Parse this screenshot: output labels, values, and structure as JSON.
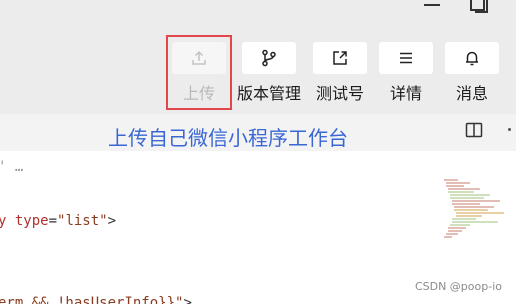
{
  "toolbar": {
    "items": [
      {
        "label": "上传",
        "icon": "upload-icon",
        "state": "disabled"
      },
      {
        "label": "版本管理",
        "icon": "branch-icon"
      },
      {
        "label": "测试号",
        "icon": "external-link-icon"
      },
      {
        "label": "详情",
        "icon": "menu-icon"
      },
      {
        "label": "消息",
        "icon": "bell-icon"
      }
    ],
    "highlight_color": "#e0464b"
  },
  "editor": {
    "overlay_title": "上传自己微信小程序工作台",
    "code_lines": [
      {
        "text": "' …"
      },
      {
        "text": "y type=\"list\">"
      },
      {
        "text": "erm && !hasUserInfo}}\">"
      }
    ]
  },
  "watermark": "CSDN @poop-io",
  "colors": {
    "title_blue": "#3a67d4",
    "toolbar_bg": "#ececec"
  }
}
